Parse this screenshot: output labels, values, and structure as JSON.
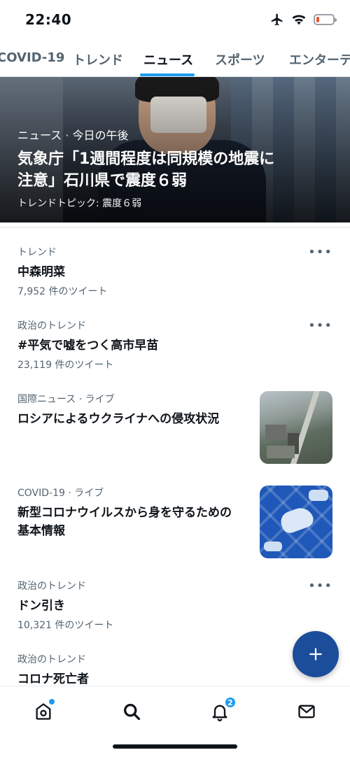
{
  "status": {
    "time": "22:40",
    "battery_level": 0.2,
    "battery_color": "#e8542d"
  },
  "tabs": [
    {
      "label": "COVID-19",
      "active": false
    },
    {
      "label": "トレンド",
      "active": false
    },
    {
      "label": "ニュース",
      "active": true
    },
    {
      "label": "スポーツ",
      "active": false
    },
    {
      "label": "エンターテ",
      "active": false
    }
  ],
  "hero": {
    "category": "ニュース",
    "time": "今日の午後",
    "title_line1": "気象庁「1週間程度は同規模の地震に",
    "title_line2": "注意」石川県で震度６弱",
    "topic": "トレンドトピック: 震度６弱"
  },
  "trends": [
    {
      "category": "トレンド",
      "sub": "",
      "title": "中森明菜",
      "count": "7,952 件のツイート",
      "more": "•••"
    },
    {
      "category": "政治のトレンド",
      "sub": "",
      "title": "#平気で嘘をつく高市早苗",
      "count": "23,119 件のツイート",
      "more": "•••"
    },
    {
      "category": "国際ニュース",
      "sub": "· ライブ",
      "title": "ロシアによるウクライナへの侵攻状況",
      "count": ""
    },
    {
      "category": "COVID-19",
      "sub": "· ライブ",
      "title_line1": "新型コロナウイルスから身を守るための",
      "title_line2": "基本情報",
      "count": ""
    },
    {
      "category": "政治のトレンド",
      "sub": "",
      "title": "ドン引き",
      "count": "10,321 件のツイート",
      "more": "•••"
    },
    {
      "category": "政治のトレンド",
      "sub": "",
      "title": "コロナ死亡者",
      "count": ""
    }
  ],
  "fab": {
    "icon": "plus-icon",
    "color": "#1c4d9a"
  },
  "bottom_nav": {
    "items": [
      "home-icon",
      "search-icon",
      "bell-icon",
      "mail-icon"
    ],
    "notifications_badge": "2",
    "accent": "#1d9bf0"
  }
}
